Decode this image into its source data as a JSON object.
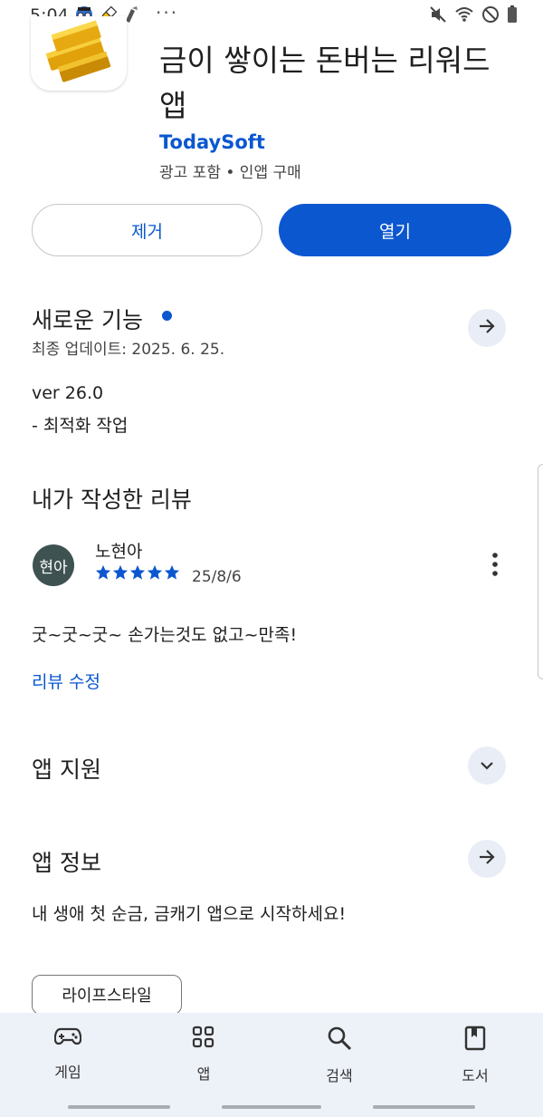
{
  "status_bar": {
    "time": "5:04",
    "icons_left": [
      "avatar-icon",
      "capsule-icon",
      "brush-icon"
    ],
    "more": "···",
    "icons_right": [
      "mute-icon",
      "wifi-icon",
      "block-icon",
      "battery-icon"
    ]
  },
  "app": {
    "title": "금이 쌓이는 돈버는 리워드 앱",
    "developer": "TodaySoft",
    "meta": "광고 포함 • 인앱 구매"
  },
  "buttons": {
    "remove": "제거",
    "open": "열기"
  },
  "whats_new": {
    "title": "새로운 기능",
    "updated": "최종 업데이트: 2025. 6. 25.",
    "version": "ver 26.0",
    "note": "- 최적화 작업"
  },
  "my_review": {
    "title": "내가 작성한 리뷰",
    "avatar_text": "현아",
    "author": "노현아",
    "rating": 5,
    "date": "25/8/6",
    "text": "굿~굿~굿~ 손가는것도 없고~만족!",
    "edit_link": "리뷰 수정"
  },
  "app_support": {
    "title": "앱 지원"
  },
  "app_info": {
    "title": "앱 정보",
    "description": "내 생애 첫 순금, 금캐기 앱으로 시작하세요!",
    "category_chip": "라이프스타일"
  },
  "bottom_nav": {
    "games": "게임",
    "apps": "앱",
    "search": "검색",
    "books": "도서"
  },
  "colors": {
    "accent": "#0b57d0",
    "nav_bg": "#edf1f8",
    "chip_bg": "#e9eef6",
    "avatar_bg": "#3f5252"
  }
}
